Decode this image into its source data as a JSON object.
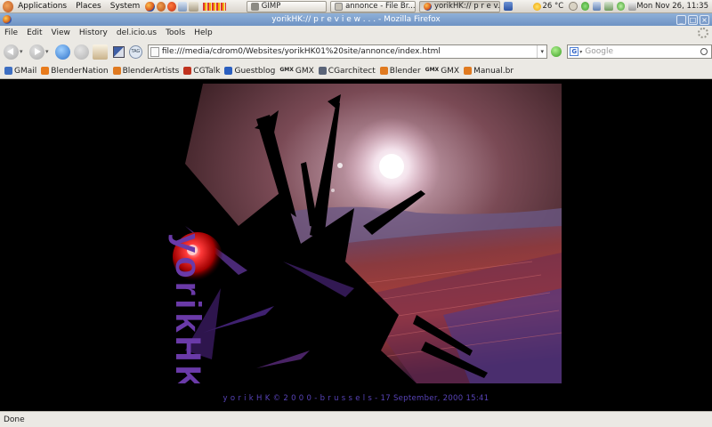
{
  "panel": {
    "menus": [
      "Applications",
      "Places",
      "System"
    ],
    "tasks": [
      {
        "label": "GIMP",
        "active": false
      },
      {
        "label": "annonce - File Br...",
        "active": false
      },
      {
        "label": "yorikHK:// p r e v...",
        "active": true
      }
    ],
    "weather": "26 °C",
    "clock": "Mon Nov 26, 11:35"
  },
  "window": {
    "title": "yorikHK:// p r e v i e w . . . - Mozilla Firefox"
  },
  "menubar": [
    "File",
    "Edit",
    "View",
    "History",
    "del.icio.us",
    "Tools",
    "Help"
  ],
  "nav": {
    "url": "file:///media/cdrom0/Websites/yorikHK01%20site/annonce/index.html",
    "search_placeholder": "Google",
    "tag_label": "TAG"
  },
  "bookmarks": [
    {
      "label": "GMail",
      "icon": "gmail-icon",
      "color": "#3e6fc2"
    },
    {
      "label": "BlenderNation",
      "icon": "rss-icon",
      "color": "#e87b1c"
    },
    {
      "label": "BlenderArtists",
      "icon": "blender-icon",
      "color": "#e07a20"
    },
    {
      "label": "CGTalk",
      "icon": "cgtalk-icon",
      "color": "#c0321e"
    },
    {
      "label": "Guestblog",
      "icon": "guestblog-icon",
      "color": "#2b5fbf"
    },
    {
      "label": "GMX",
      "icon": "gmx-icon",
      "color": "#222222",
      "prefix": "GMX"
    },
    {
      "label": "CGarchitect",
      "icon": "cgarchitect-icon",
      "color": "#5a6478"
    },
    {
      "label": "Blender",
      "icon": "blender-icon",
      "color": "#e07a20"
    },
    {
      "label": "GMX",
      "icon": "gmx-icon",
      "color": "#222222",
      "prefix": "GMX"
    },
    {
      "label": "Manual.br",
      "icon": "blender-icon",
      "color": "#e07a20"
    }
  ],
  "page": {
    "logo_text": "yorikHK",
    "footer": "y o r i k H K © 2 0 0 0 - b r u s s e l s - 17 September, 2000 15:41",
    "footer_color": "#5843b8"
  },
  "status": "Done"
}
